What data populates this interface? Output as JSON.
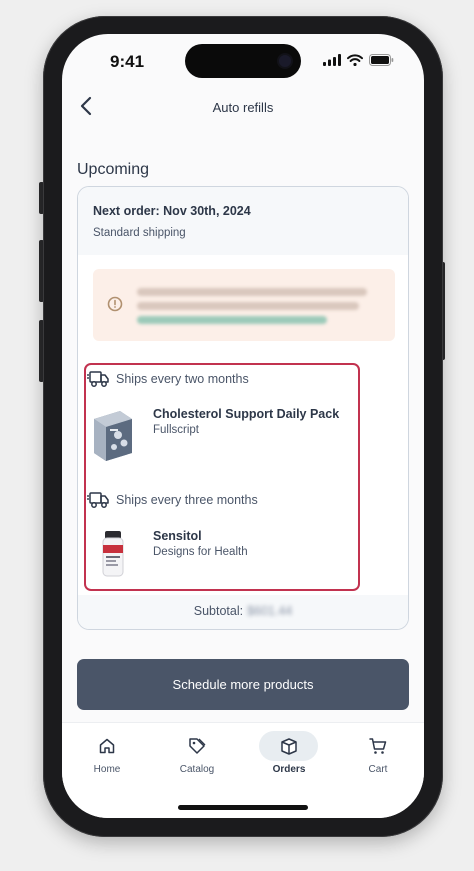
{
  "status_bar": {
    "time": "9:41"
  },
  "header": {
    "title": "Auto refills"
  },
  "section": {
    "title": "Upcoming"
  },
  "order": {
    "next_order": "Next order: Nov 30th, 2024",
    "shipping": "Standard shipping",
    "notice": {
      "line1": "This order will ship separately from your other Nov 30",
      "line2": "order, because it has a different discount applied.",
      "link": "Learn more about combining shipments"
    },
    "groups": [
      {
        "frequency": "Ships every two months",
        "product_name": "Cholesterol Support Daily Pack",
        "brand": "Fullscript"
      },
      {
        "frequency": "Ships every three months",
        "product_name": "Sensitol",
        "brand": "Designs for Health"
      }
    ],
    "subtotal_label": "Subtotal:",
    "subtotal_value": "$601.44"
  },
  "cta": {
    "label": "Schedule more products"
  },
  "tabs": [
    {
      "label": "Home",
      "icon": "home-icon"
    },
    {
      "label": "Catalog",
      "icon": "tag-icon"
    },
    {
      "label": "Orders",
      "icon": "box-icon"
    },
    {
      "label": "Cart",
      "icon": "cart-icon"
    }
  ],
  "colors": {
    "primary": "#4a5568",
    "highlight": "#c2324f",
    "notice_bg": "#fcefe8",
    "active_tab": "#e8edf1"
  }
}
